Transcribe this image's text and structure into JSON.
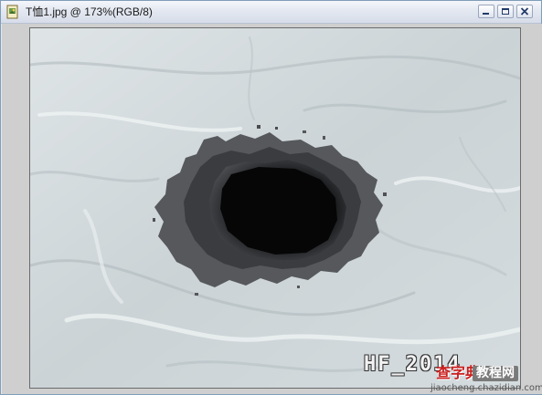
{
  "window": {
    "title": "T恤1.jpg @ 173%(RGB/8)",
    "icon": "document-image-icon",
    "controls": {
      "minimize_icon": "minimize-icon",
      "maximize_icon": "maximize-icon",
      "close_icon": "close-icon"
    }
  },
  "canvas": {
    "subject": "t-shirt-fabric",
    "colors": {
      "fabric": "#cfd6d9",
      "hole_outer": "#585a5e",
      "hole_mid": "#2e3033",
      "hole_core": "#0a0b0c",
      "frame": "#cfcfcf"
    }
  },
  "watermark": {
    "logo_text": "HF_2014",
    "site_cn_left": "查字典",
    "site_cn_right": "教程网",
    "site_url": "jiaocheng.chazidian.com"
  }
}
